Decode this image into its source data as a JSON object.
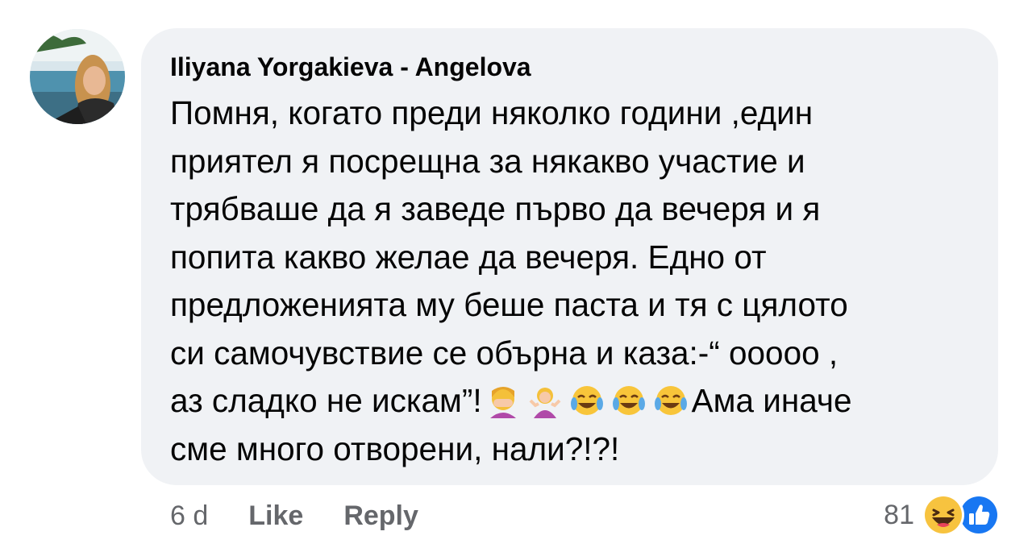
{
  "comment": {
    "author": "Iliyana Yorgakieva - Angelova",
    "avatar_icon": "profile-photo-beach",
    "text_before_emoji": "Помня, когато преди няколко години ,един\nприятел я посрещна за някакво участие и\nтрябваше да я заведе първо да вечеря и я\nпопита какво желае да вечеря. Едно от\nпредложенията му беше паста и тя с цялото\nси самочувствие се обърна и каза:-“ ооооо ,\nаз сладко не искам”!",
    "text_after_emoji": "Ама иначе\nсме много отворени, нали?!?!",
    "emojis": [
      "face-palm-emoji",
      "shrug-emoji",
      "tears-of-joy-emoji",
      "tears-of-joy-emoji",
      "tears-of-joy-emoji"
    ],
    "time": "6 d",
    "like_label": "Like",
    "reply_label": "Reply",
    "reaction_count": "81",
    "reaction_icons": [
      "haha-reaction-icon",
      "like-reaction-icon"
    ]
  },
  "colors": {
    "bubble_bg": "#f0f2f5",
    "meta_text": "#65676b",
    "like_blue": "#1877f2"
  }
}
